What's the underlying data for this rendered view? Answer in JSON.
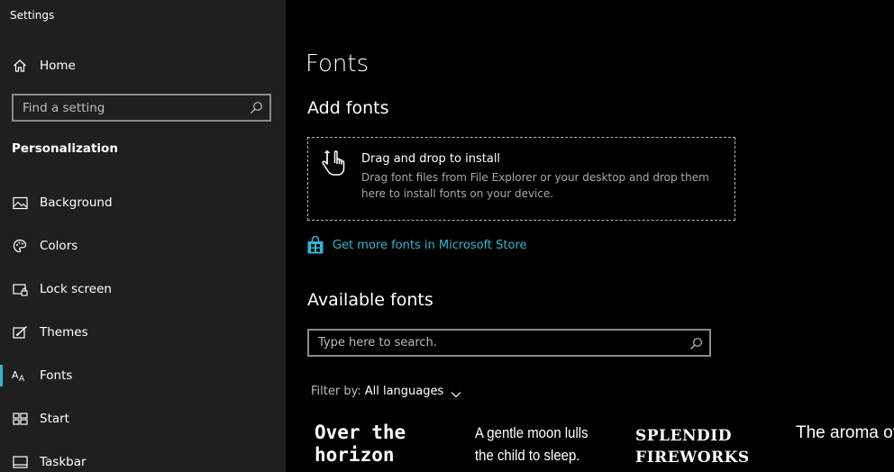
{
  "window": {
    "title": "Settings"
  },
  "sidebar": {
    "home_label": "Home",
    "search_placeholder": "Find a setting",
    "section_label": "Personalization",
    "items": [
      {
        "label": "Background",
        "icon": "picture-icon"
      },
      {
        "label": "Colors",
        "icon": "palette-icon"
      },
      {
        "label": "Lock screen",
        "icon": "lock-screen-icon"
      },
      {
        "label": "Themes",
        "icon": "themes-icon"
      },
      {
        "label": "Fonts",
        "icon": "fonts-icon",
        "active": true
      },
      {
        "label": "Start",
        "icon": "start-icon"
      },
      {
        "label": "Taskbar",
        "icon": "taskbar-icon"
      }
    ]
  },
  "main": {
    "title": "Fonts",
    "add_fonts": {
      "heading": "Add fonts",
      "drop_title": "Drag and drop to install",
      "drop_description": "Drag font files from File Explorer or your desktop and drop them here to install fonts on your device.",
      "store_link": "Get more fonts in Microsoft Store"
    },
    "available_fonts": {
      "heading": "Available fonts",
      "search_placeholder": "Type here to search.",
      "filter_label": "Filter by:",
      "filter_value": "All languages",
      "previews": [
        "Over the horizon",
        "A gentle moon lulls the child to sleep.",
        "SPLENDID FIREWORKS",
        "The aroma of baking bread"
      ]
    }
  },
  "colors": {
    "accent": "#2fb7d4",
    "sidebar_bg": "#1f1f1f",
    "main_bg": "#000000"
  }
}
